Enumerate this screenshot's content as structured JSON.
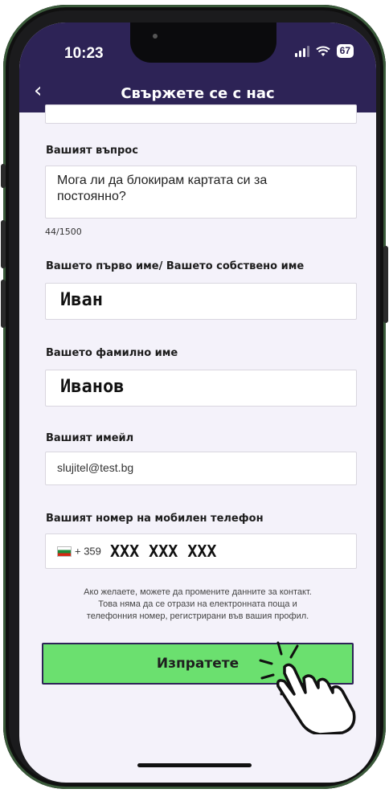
{
  "status_bar": {
    "time": "10:23",
    "battery": "67"
  },
  "header": {
    "title": "Свържете се с нас",
    "back_icon": "‹"
  },
  "form": {
    "question_label": "Вашият въпрос",
    "question_value_line1": "Мога ли да блокирам картата си за",
    "question_value_line2": "постоянно?",
    "question_counter": "44/1500",
    "first_name_label": "Вашето първо име/ Вашето собствено име",
    "first_name_value": "Иван",
    "last_name_label": "Вашето фамилно име",
    "last_name_value": "Иванов",
    "email_label": "Вашият имейл",
    "email_value": "slujitel@test.bg",
    "phone_label": "Вашият номер на мобилен телефон",
    "phone_prefix": "+ 359",
    "phone_value": "XXX XXX XXX",
    "note_line1": "Ако желаете, можете да промените данните за контакт.",
    "note_line2": "Това няма да се отрази на електронната поща и",
    "note_line3": "телефонния номер, регистрирани във вашия профил.",
    "submit_label": "Изпратете"
  },
  "colors": {
    "header_bg": "#2d2356",
    "screen_bg": "#f4f2fa",
    "submit_bg": "#6be06f",
    "submit_border": "#2d2356"
  },
  "icons": [
    "back-chevron-icon",
    "signal-icon",
    "wifi-icon",
    "battery-icon",
    "bulgaria-flag-icon",
    "tap-hand-icon"
  ]
}
